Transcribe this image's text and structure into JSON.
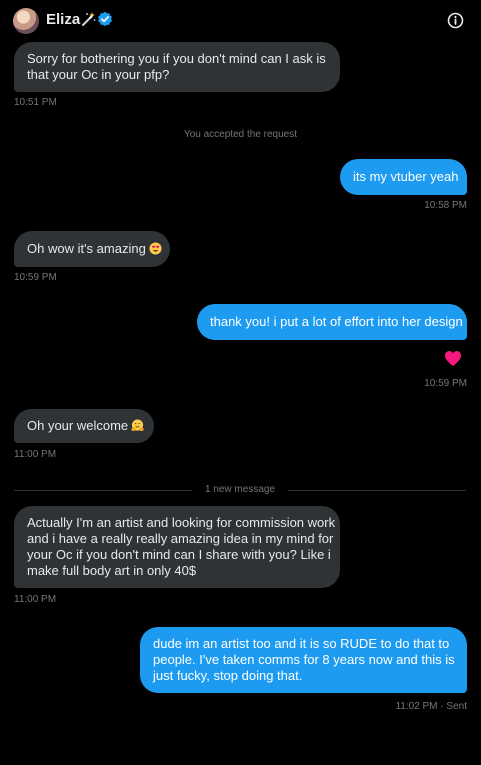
{
  "header": {
    "display_name": "Eliza",
    "icons": {
      "wand": "magic-wand-icon",
      "verified": "verified-badge-icon",
      "info": "info-icon"
    },
    "accent_color": "#1d9bf0"
  },
  "messages": [
    {
      "direction": "incoming",
      "lines": [
        "Sorry for bothering you if you don't mind can I ask is",
        "that your Oc in your pfp?"
      ],
      "time": "10:51 PM"
    },
    {
      "type": "system",
      "text": "You accepted the request"
    },
    {
      "direction": "outgoing",
      "lines": [
        "its my vtuber yeah"
      ],
      "time": "10:58 PM"
    },
    {
      "direction": "incoming",
      "lines": [
        "Oh wow it's amazing"
      ],
      "emoji": "heart-eyes-emoji",
      "time": "10:59 PM"
    },
    {
      "direction": "outgoing",
      "lines": [
        "thank you! i put a lot of effort into her design"
      ],
      "reaction": "heart-icon",
      "time": "10:59 PM"
    },
    {
      "direction": "incoming",
      "lines": [
        "Oh your welcome"
      ],
      "emoji": "hugging-face-emoji",
      "time": "11:00 PM"
    },
    {
      "type": "divider",
      "text": "1 new message"
    },
    {
      "direction": "incoming",
      "lines": [
        "Actually I'm an artist and looking for commission work",
        "and i have a really really amazing idea in my mind for",
        "your Oc if you don't mind can I share with you? Like i",
        "make full body art in only 40$"
      ],
      "time": "11:00 PM"
    },
    {
      "direction": "outgoing",
      "lines": [
        "dude im an artist too and it is so RUDE to do that to",
        "people. I've taken comms for 8 years now and this is",
        "just fucky, stop doing that."
      ],
      "time": "11:02 PM",
      "status": "Sent",
      "separator": "·"
    }
  ],
  "colors": {
    "background": "#000000",
    "incoming_bubble": "#2f3336",
    "outgoing_bubble": "#1d9bf0",
    "muted_text": "#71767b",
    "heart_reaction": "#f91880"
  }
}
